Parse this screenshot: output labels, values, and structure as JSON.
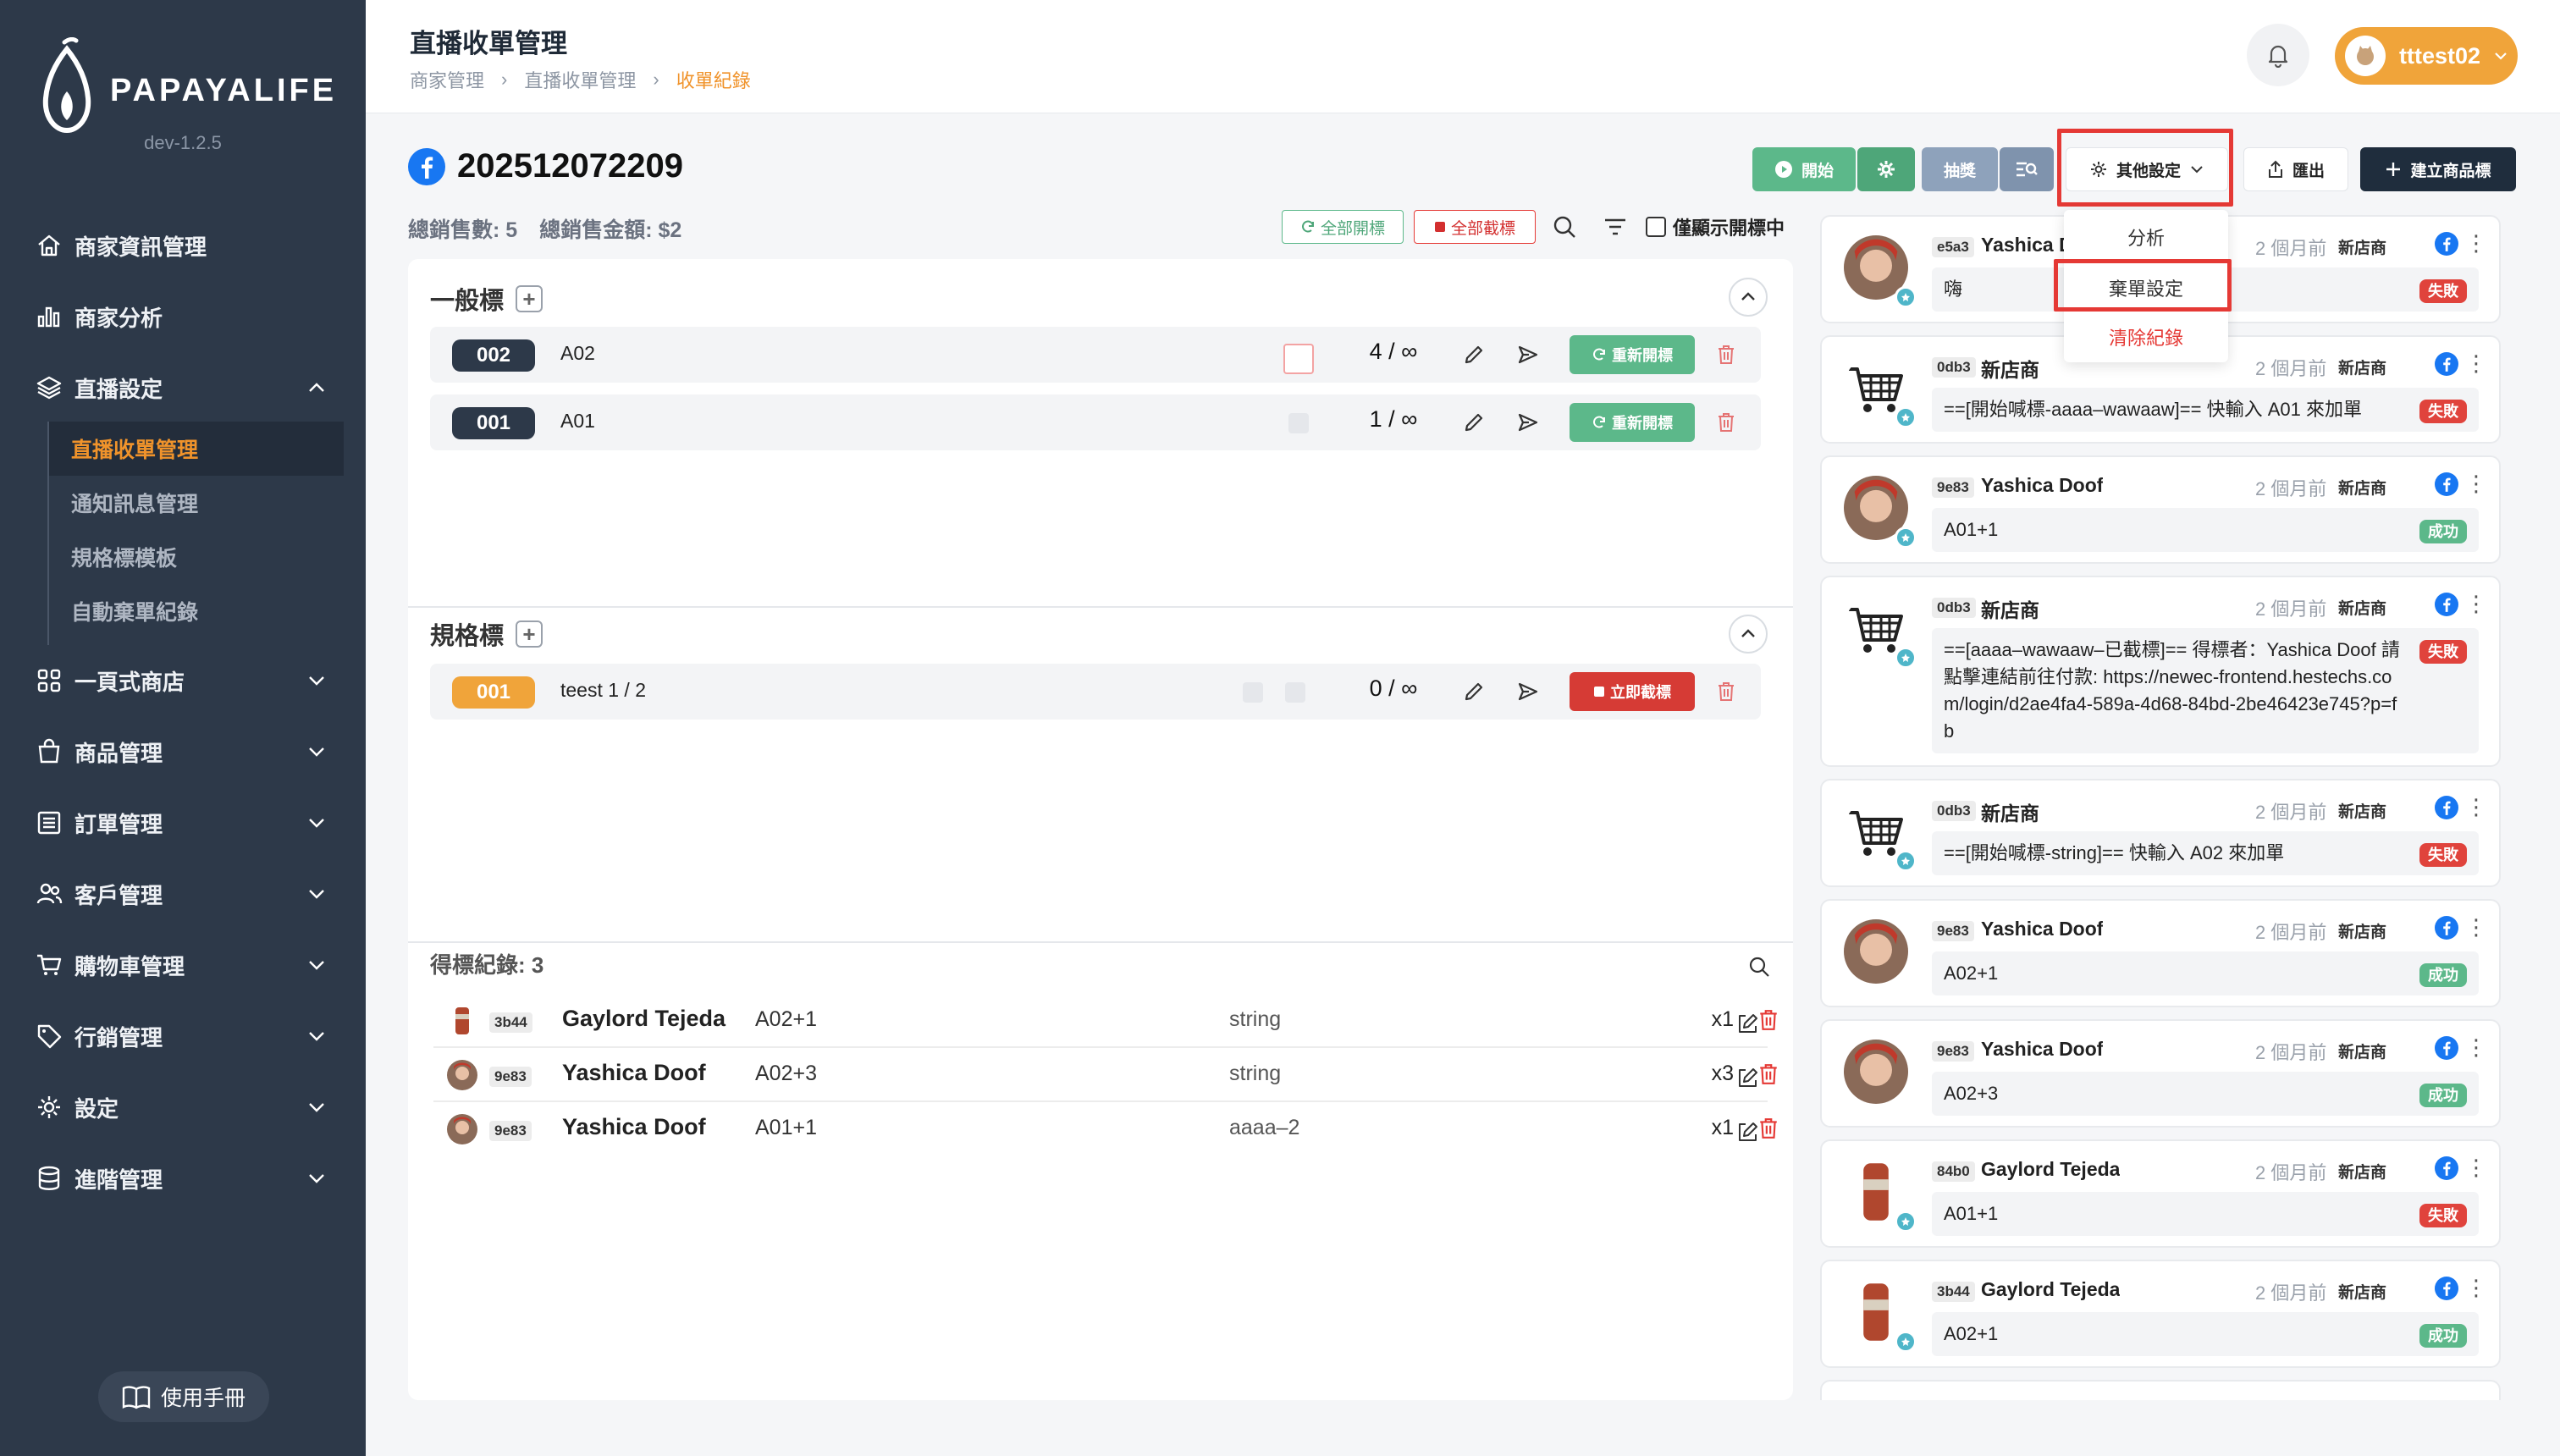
{
  "sidebar": {
    "brand": "PAPAYALIFE",
    "version": "dev-1.2.5",
    "items": [
      {
        "label": "商家資訊管理",
        "icon": "home-icon"
      },
      {
        "label": "商家分析",
        "icon": "bar-chart-icon"
      },
      {
        "label": "直播設定",
        "icon": "layers-icon",
        "expanded": true
      },
      {
        "label": "一頁式商店",
        "icon": "grid-icon"
      },
      {
        "label": "商品管理",
        "icon": "shopping-bag-icon"
      },
      {
        "label": "訂單管理",
        "icon": "list-icon"
      },
      {
        "label": "客戶管理",
        "icon": "users-icon"
      },
      {
        "label": "購物車管理",
        "icon": "cart-icon"
      },
      {
        "label": "行銷管理",
        "icon": "tag-icon"
      },
      {
        "label": "設定",
        "icon": "gear-icon"
      },
      {
        "label": "進階管理",
        "icon": "database-icon"
      }
    ],
    "sub_items": [
      "直播收單管理",
      "通知訊息管理",
      "規格標模板",
      "自動棄單紀錄"
    ],
    "manual": "使用手冊"
  },
  "header": {
    "title": "直播收單管理",
    "breadcrumb": [
      "商家管理",
      "直播收單管理",
      "收單紀錄"
    ],
    "user": "tttest02"
  },
  "stream": {
    "id": "202512072209",
    "total_count_label": "總銷售數: 5",
    "total_amount_label": "總銷售金額: $2"
  },
  "toolbar": {
    "start": "開始",
    "lottery": "抽獎",
    "other_settings": "其他設定",
    "export": "匯出",
    "create_tag": "建立商品標",
    "open_all": "全部開標",
    "close_all": "全部截標",
    "only_open": "僅顯示開標中"
  },
  "dropdown": {
    "items": [
      "分析",
      "棄單設定",
      "清除紀錄"
    ],
    "highlighted": "棄單設定"
  },
  "general": {
    "title": "一般標",
    "rows": [
      {
        "tag": "002",
        "name": "A02",
        "count": "4 / ∞",
        "action": "重新開標"
      },
      {
        "tag": "001",
        "name": "A01",
        "count": "1 / ∞",
        "action": "重新開標"
      }
    ]
  },
  "spec": {
    "title": "規格標",
    "rows": [
      {
        "tag": "001",
        "name": "teest  1 / 2",
        "count": "0 / ∞",
        "action": "立即截標"
      }
    ]
  },
  "winners": {
    "title": "得標紀錄: 3",
    "rows": [
      {
        "id": "3b44",
        "name": "Gaylord Tejeda",
        "item": "A02+1",
        "spec": "string",
        "qty": "x1"
      },
      {
        "id": "9e83",
        "name": "Yashica Doof",
        "item": "A02+3",
        "spec": "string",
        "qty": "x3"
      },
      {
        "id": "9e83",
        "name": "Yashica Doof",
        "item": "A01+1",
        "spec": "aaaa–2",
        "qty": "x1"
      }
    ]
  },
  "feed": [
    {
      "id": "e5a3",
      "name": "Yashica D",
      "time": "2 個月前",
      "store": "新店商",
      "message": "嗨",
      "status": "失敗",
      "avatar": "person"
    },
    {
      "id": "0db3",
      "name": "新店商",
      "time": "2 個月前",
      "store": "新店商",
      "message": "==[開始喊標-aaaa–wawaaw]== 快輸入 A01 來加單",
      "status": "失敗",
      "avatar": "cart"
    },
    {
      "id": "9e83",
      "name": "Yashica Doof",
      "time": "2 個月前",
      "store": "新店商",
      "message": "A01+1",
      "status": "成功",
      "avatar": "person"
    },
    {
      "id": "0db3",
      "name": "新店商",
      "time": "2 個月前",
      "store": "新店商",
      "message": "==[aaaa–wawaaw–已截標]== 得標者：Yashica Doof 請點擊連結前往付款: https://newec-frontend.hestechs.com/login/d2ae4fa4-589a-4d68-84bd-2be46423e745?p=fb",
      "status": "失敗",
      "avatar": "cart"
    },
    {
      "id": "0db3",
      "name": "新店商",
      "time": "2 個月前",
      "store": "新店商",
      "message": "==[開始喊標-string]== 快輸入 A02 來加單",
      "status": "失敗",
      "avatar": "cart"
    },
    {
      "id": "9e83",
      "name": "Yashica Doof",
      "time": "2 個月前",
      "store": "新店商",
      "message": "A02+1",
      "status": "成功",
      "avatar": "person"
    },
    {
      "id": "9e83",
      "name": "Yashica Doof",
      "time": "2 個月前",
      "store": "新店商",
      "message": "A02+3",
      "status": "成功",
      "avatar": "person"
    },
    {
      "id": "84b0",
      "name": "Gaylord Tejeda",
      "time": "2 個月前",
      "store": "新店商",
      "message": "A01+1",
      "status": "失敗",
      "avatar": "can"
    },
    {
      "id": "3b44",
      "name": "Gaylord Tejeda",
      "time": "2 個月前",
      "store": "新店商",
      "message": "A02+1",
      "status": "成功",
      "avatar": "can"
    }
  ],
  "colors": {
    "sidebar_bg": "#2d3949",
    "accent_orange": "#f0932b",
    "green": "#5cb88a",
    "red": "#e53935",
    "navy": "#1f2d3d"
  }
}
